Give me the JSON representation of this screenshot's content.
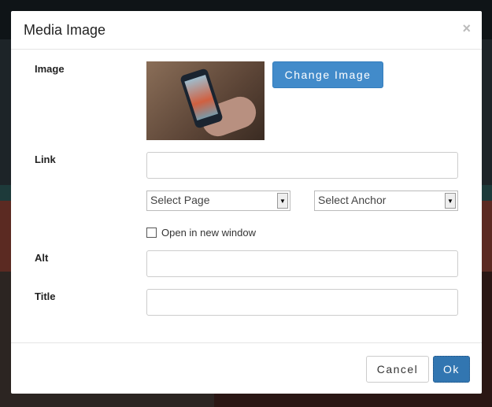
{
  "dialog": {
    "title": "Media Image",
    "close_label": "×"
  },
  "form": {
    "image_label": "Image",
    "change_image_label": "Change Image",
    "link_label": "Link",
    "link_value": "",
    "select_page": "Select Page",
    "select_anchor": "Select Anchor",
    "open_new_window_label": "Open in new window",
    "alt_label": "Alt",
    "alt_value": "",
    "title_label": "Title",
    "title_value": ""
  },
  "footer": {
    "cancel_label": "Cancel",
    "ok_label": "Ok"
  }
}
